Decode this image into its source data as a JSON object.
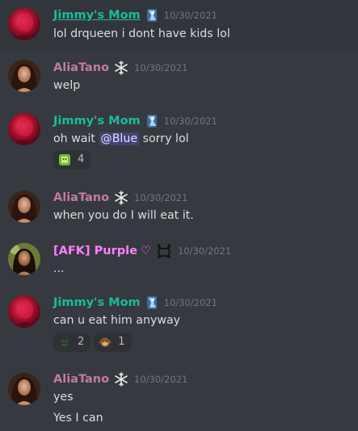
{
  "messages": [
    {
      "author": "Jimmy's Mom",
      "timestamp": "10/30/2021",
      "lines": [
        "lol drqueen i dont have kids lol"
      ]
    },
    {
      "author": "AliaTano",
      "timestamp": "10/30/2021",
      "lines": [
        "welp"
      ]
    },
    {
      "author": "Jimmy's Mom",
      "timestamp": "10/30/2021",
      "text_before_mention": "oh wait ",
      "mention": "@Blue",
      "text_after_mention": " sorry lol",
      "reactions": [
        {
          "emoji": "green-emoji-icon",
          "count": "4"
        }
      ]
    },
    {
      "author": "AliaTano",
      "timestamp": "10/30/2021",
      "lines": [
        "when you do I will eat it."
      ]
    },
    {
      "author": "[AFK] Purple",
      "author_suffix": "♡",
      "timestamp": "10/30/2021",
      "lines": [
        "..."
      ]
    },
    {
      "author": "Jimmy's Mom",
      "timestamp": "10/30/2021",
      "lines": [
        "can u eat him anyway"
      ],
      "reactions": [
        {
          "emoji": "dark-emoji-icon",
          "count": "2"
        },
        {
          "emoji": "monkey-emoji-icon",
          "count": "1"
        }
      ]
    },
    {
      "author": "AliaTano",
      "timestamp": "10/30/2021",
      "lines": [
        "yes",
        "Yes I can"
      ]
    }
  ],
  "colors": {
    "background": "#36393f",
    "jimmy_name": "#1abc9c",
    "alia_name": "#c27ca0",
    "purple_name": "#ff80ff",
    "timestamp": "#72767d",
    "mention_bg": "#414675"
  }
}
